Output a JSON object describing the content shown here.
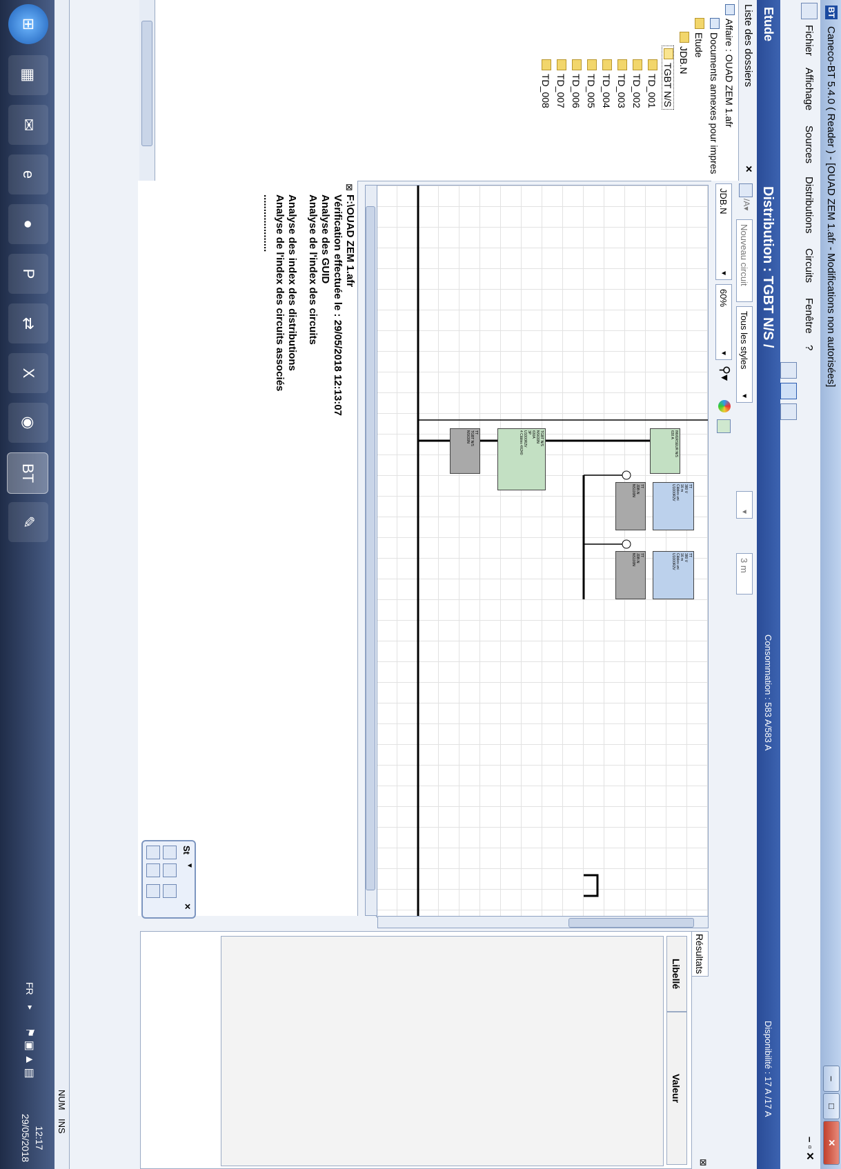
{
  "window": {
    "title": "Caneco-BT 5.4.0 ( Reader ) - [OUAD ZEM 1.afr - Modifications non autorisées]",
    "app_icon": "BT"
  },
  "menu": [
    "Fichier",
    "Affichage",
    "Sources",
    "Distributions",
    "Circuits",
    "Fenêtre",
    "?"
  ],
  "header": {
    "section": "Etude",
    "title": "Distribution : TGBT N/S /",
    "consumption": "Consommation : 583 A/583 A",
    "availability": "Disponibilité : 17 A /17 A"
  },
  "sidebar": {
    "title": "Liste des dossiers",
    "close": "×",
    "tree": [
      {
        "label": "Affaire : OUAD ZEM 1.afr"
      },
      {
        "label": "Documents annexes pour impres"
      },
      {
        "label": "Etude"
      },
      {
        "label": "JDB.N"
      },
      {
        "label": "TGBT N/S"
      },
      {
        "label": "TD_001"
      },
      {
        "label": "TD_002"
      },
      {
        "label": "TD_003"
      },
      {
        "label": "TD_004"
      },
      {
        "label": "TD_005"
      },
      {
        "label": "TD_006"
      },
      {
        "label": "TD_007"
      },
      {
        "label": "TD_008"
      }
    ]
  },
  "toolbar": {
    "new_circuit": "Nouveau circuit",
    "all_styles": "Tous les styles",
    "distribution": "JDB.N",
    "zoom": "60%",
    "length": "3 m"
  },
  "diagram": {
    "blocks": [
      {
        "lines": [
          "INVERSEUR N/S",
          "630 A"
        ],
        "color": "green"
      },
      {
        "lines": [
          "TGBT N/S",
          "NS630N",
          "630A",
          "3P",
          "U1000R2V",
          "4 Câbles 4X240"
        ],
        "color": "green"
      },
      {
        "lines": [
          "TT",
          "TGBT N/S",
          "NS630N"
        ],
        "color": "gray"
      },
      {
        "lines": [
          "TT",
          "JDB.N",
          "NS100N"
        ],
        "color": "gray"
      },
      {
        "lines": [
          "TT",
          "380 V",
          "16 m",
          "Câbles uni",
          "U1000R2V"
        ],
        "color": "blue"
      },
      {
        "lines": [
          "TT",
          "JDB.N",
          "NS100N"
        ],
        "color": "gray"
      },
      {
        "lines": [
          "TT",
          "380 V",
          "16 m",
          "Câbles uni",
          "U1000R2V"
        ],
        "color": "blue"
      }
    ]
  },
  "log": {
    "lines": [
      "F:\\OUAD ZEM 1.afr",
      "Vérification effectuée le : 29/05/2018 12:13:07",
      "Analyse des GUID",
      "Analyse de l'index des circuits",
      "Analyse des index des distributions",
      "Analyse de l'index des circuits associés",
      "...................."
    ]
  },
  "results": {
    "tab": "Résultats",
    "col_label": "Libellé",
    "col_value": "Valeur"
  },
  "palette": {
    "title": "St",
    "close": "×"
  },
  "status": {
    "num": "NUM",
    "ins": "INS"
  },
  "taskbar": {
    "lang": "FR",
    "time": "12:17",
    "date": "29/05/2018"
  },
  "icons": [
    "windows-start-icon",
    "excel-grid-icon",
    "outlook-icon",
    "internet-explorer-icon",
    "firefox-icon",
    "powerpoint-icon",
    "network-icon",
    "excel-icon",
    "antivirus-icon",
    "caneco-bt-icon",
    "paint-icon"
  ]
}
